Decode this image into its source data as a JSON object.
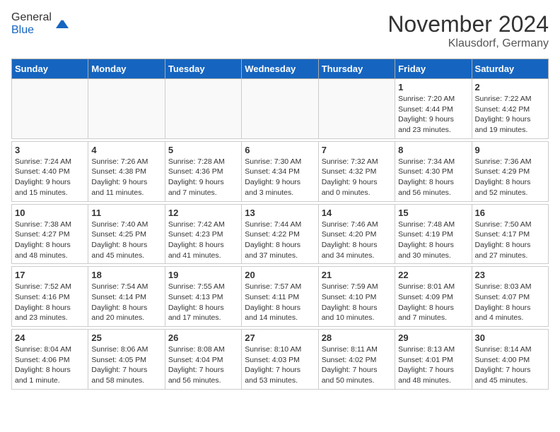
{
  "header": {
    "logo_general": "General",
    "logo_blue": "Blue",
    "month_title": "November 2024",
    "location": "Klausdorf, Germany"
  },
  "days_of_week": [
    "Sunday",
    "Monday",
    "Tuesday",
    "Wednesday",
    "Thursday",
    "Friday",
    "Saturday"
  ],
  "weeks": [
    {
      "days": [
        {
          "date": "",
          "info": ""
        },
        {
          "date": "",
          "info": ""
        },
        {
          "date": "",
          "info": ""
        },
        {
          "date": "",
          "info": ""
        },
        {
          "date": "",
          "info": ""
        },
        {
          "date": "1",
          "info": "Sunrise: 7:20 AM\nSunset: 4:44 PM\nDaylight: 9 hours\nand 23 minutes."
        },
        {
          "date": "2",
          "info": "Sunrise: 7:22 AM\nSunset: 4:42 PM\nDaylight: 9 hours\nand 19 minutes."
        }
      ]
    },
    {
      "days": [
        {
          "date": "3",
          "info": "Sunrise: 7:24 AM\nSunset: 4:40 PM\nDaylight: 9 hours\nand 15 minutes."
        },
        {
          "date": "4",
          "info": "Sunrise: 7:26 AM\nSunset: 4:38 PM\nDaylight: 9 hours\nand 11 minutes."
        },
        {
          "date": "5",
          "info": "Sunrise: 7:28 AM\nSunset: 4:36 PM\nDaylight: 9 hours\nand 7 minutes."
        },
        {
          "date": "6",
          "info": "Sunrise: 7:30 AM\nSunset: 4:34 PM\nDaylight: 9 hours\nand 3 minutes."
        },
        {
          "date": "7",
          "info": "Sunrise: 7:32 AM\nSunset: 4:32 PM\nDaylight: 9 hours\nand 0 minutes."
        },
        {
          "date": "8",
          "info": "Sunrise: 7:34 AM\nSunset: 4:30 PM\nDaylight: 8 hours\nand 56 minutes."
        },
        {
          "date": "9",
          "info": "Sunrise: 7:36 AM\nSunset: 4:29 PM\nDaylight: 8 hours\nand 52 minutes."
        }
      ]
    },
    {
      "days": [
        {
          "date": "10",
          "info": "Sunrise: 7:38 AM\nSunset: 4:27 PM\nDaylight: 8 hours\nand 48 minutes."
        },
        {
          "date": "11",
          "info": "Sunrise: 7:40 AM\nSunset: 4:25 PM\nDaylight: 8 hours\nand 45 minutes."
        },
        {
          "date": "12",
          "info": "Sunrise: 7:42 AM\nSunset: 4:23 PM\nDaylight: 8 hours\nand 41 minutes."
        },
        {
          "date": "13",
          "info": "Sunrise: 7:44 AM\nSunset: 4:22 PM\nDaylight: 8 hours\nand 37 minutes."
        },
        {
          "date": "14",
          "info": "Sunrise: 7:46 AM\nSunset: 4:20 PM\nDaylight: 8 hours\nand 34 minutes."
        },
        {
          "date": "15",
          "info": "Sunrise: 7:48 AM\nSunset: 4:19 PM\nDaylight: 8 hours\nand 30 minutes."
        },
        {
          "date": "16",
          "info": "Sunrise: 7:50 AM\nSunset: 4:17 PM\nDaylight: 8 hours\nand 27 minutes."
        }
      ]
    },
    {
      "days": [
        {
          "date": "17",
          "info": "Sunrise: 7:52 AM\nSunset: 4:16 PM\nDaylight: 8 hours\nand 23 minutes."
        },
        {
          "date": "18",
          "info": "Sunrise: 7:54 AM\nSunset: 4:14 PM\nDaylight: 8 hours\nand 20 minutes."
        },
        {
          "date": "19",
          "info": "Sunrise: 7:55 AM\nSunset: 4:13 PM\nDaylight: 8 hours\nand 17 minutes."
        },
        {
          "date": "20",
          "info": "Sunrise: 7:57 AM\nSunset: 4:11 PM\nDaylight: 8 hours\nand 14 minutes."
        },
        {
          "date": "21",
          "info": "Sunrise: 7:59 AM\nSunset: 4:10 PM\nDaylight: 8 hours\nand 10 minutes."
        },
        {
          "date": "22",
          "info": "Sunrise: 8:01 AM\nSunset: 4:09 PM\nDaylight: 8 hours\nand 7 minutes."
        },
        {
          "date": "23",
          "info": "Sunrise: 8:03 AM\nSunset: 4:07 PM\nDaylight: 8 hours\nand 4 minutes."
        }
      ]
    },
    {
      "days": [
        {
          "date": "24",
          "info": "Sunrise: 8:04 AM\nSunset: 4:06 PM\nDaylight: 8 hours\nand 1 minute."
        },
        {
          "date": "25",
          "info": "Sunrise: 8:06 AM\nSunset: 4:05 PM\nDaylight: 7 hours\nand 58 minutes."
        },
        {
          "date": "26",
          "info": "Sunrise: 8:08 AM\nSunset: 4:04 PM\nDaylight: 7 hours\nand 56 minutes."
        },
        {
          "date": "27",
          "info": "Sunrise: 8:10 AM\nSunset: 4:03 PM\nDaylight: 7 hours\nand 53 minutes."
        },
        {
          "date": "28",
          "info": "Sunrise: 8:11 AM\nSunset: 4:02 PM\nDaylight: 7 hours\nand 50 minutes."
        },
        {
          "date": "29",
          "info": "Sunrise: 8:13 AM\nSunset: 4:01 PM\nDaylight: 7 hours\nand 48 minutes."
        },
        {
          "date": "30",
          "info": "Sunrise: 8:14 AM\nSunset: 4:00 PM\nDaylight: 7 hours\nand 45 minutes."
        }
      ]
    }
  ]
}
